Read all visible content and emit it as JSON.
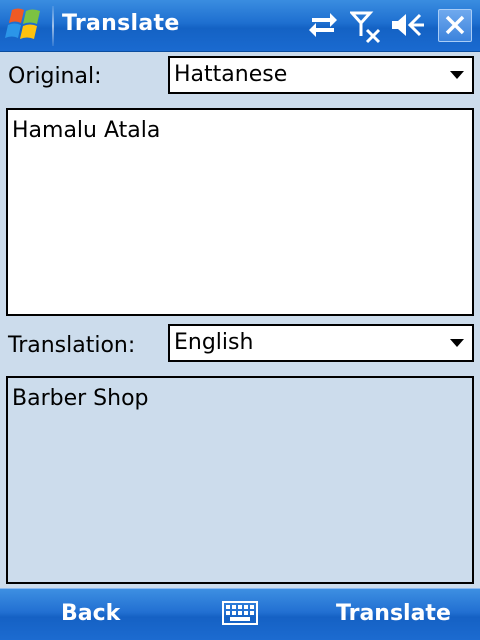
{
  "titlebar": {
    "title": "Translate",
    "icons": [
      "windows-start-icon",
      "sync-arrows-icon",
      "no-signal-icon",
      "speaker-icon",
      "close-icon"
    ]
  },
  "original": {
    "label": "Original:",
    "language": "Hattanese",
    "text": "Hamalu Atala"
  },
  "translation": {
    "label": "Translation:",
    "language": "English",
    "text": "Barber Shop"
  },
  "softkeys": {
    "left": "Back",
    "right": "Translate",
    "center_icon": "keyboard-icon"
  },
  "colors": {
    "titlebar": "#1e6fd0",
    "background": "#ccdcec",
    "text": "#000000",
    "softkey_text": "#ffffff"
  }
}
